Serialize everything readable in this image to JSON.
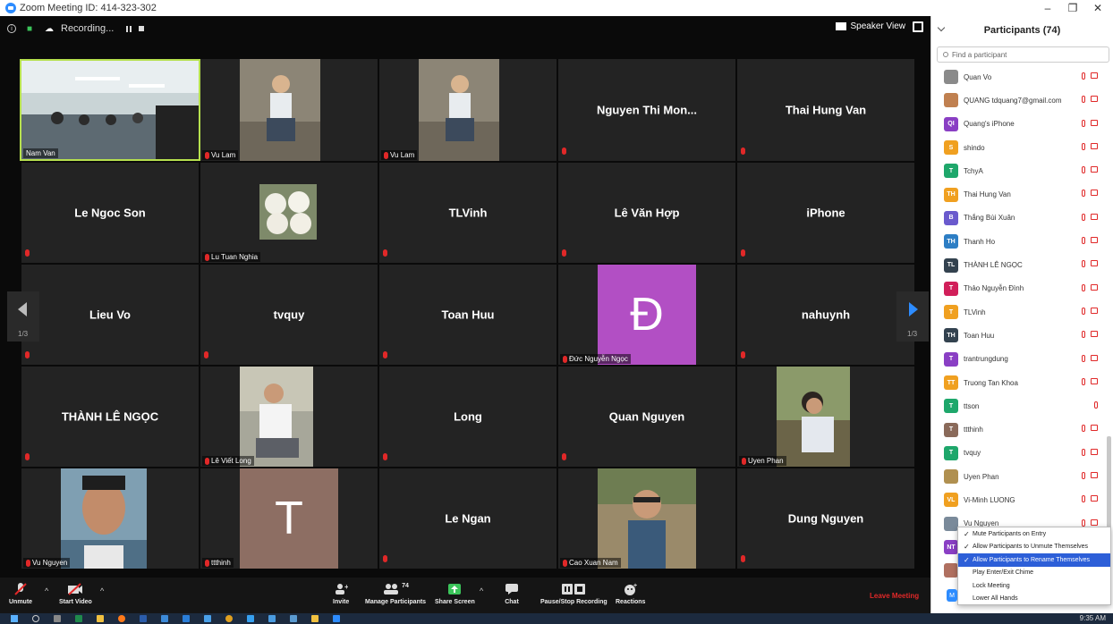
{
  "window": {
    "title": "Zoom Meeting ID: 414-323-302"
  },
  "topbar": {
    "recording_label": "Recording...",
    "speaker_view_label": "Speaker View"
  },
  "pager": {
    "left_page": "1/3",
    "right_page": "1/3"
  },
  "tiles": {
    "t1": {
      "label": "Nam Van"
    },
    "t2": {
      "label": "Vu Lam"
    },
    "t3": {
      "label": "Vu Lam"
    },
    "t4": {
      "name": "Nguyen Thi Mon..."
    },
    "t5": {
      "name": "Thai Hung Van"
    },
    "t6": {
      "name": "Le Ngoc Son"
    },
    "t7": {
      "label": "Lu Tuan Nghia"
    },
    "t8": {
      "name": "TLVinh"
    },
    "t9": {
      "name": "Lê Văn Hợp"
    },
    "t10": {
      "name": "iPhone"
    },
    "t11": {
      "name": "Lieu Vo"
    },
    "t12": {
      "name": "tvquy"
    },
    "t13": {
      "name": "Toan Huu"
    },
    "t14": {
      "label": "Đức Nguyễn Ngọc",
      "letter": "Đ"
    },
    "t15": {
      "name": "nahuynh"
    },
    "t16": {
      "name": "THÀNH LÊ NGỌC"
    },
    "t17": {
      "label": "Lê Viết Long"
    },
    "t18": {
      "name": "Long"
    },
    "t19": {
      "name": "Quan Nguyen"
    },
    "t20": {
      "label": "Uyen Phan"
    },
    "t21": {
      "label": "Vu Nguyen"
    },
    "t22": {
      "label": "ttthinh",
      "letter": "T"
    },
    "t23": {
      "name": "Le Ngan"
    },
    "t24": {
      "label": "Cao Xuan Nam"
    },
    "t25": {
      "name": "Dung Nguyen"
    }
  },
  "toolbar": {
    "unmute": "Unmute",
    "start_video": "Start Video",
    "invite": "Invite",
    "manage_participants": "Manage Participants",
    "participant_count": "74",
    "share_screen": "Share Screen",
    "chat": "Chat",
    "pause_stop_recording": "Pause/Stop Recording",
    "reactions": "Reactions",
    "leave_meeting": "Leave Meeting"
  },
  "panel": {
    "title": "Participants (74)",
    "search_placeholder": "Find a participant",
    "participants": [
      {
        "name": "Quan Vo",
        "initials": "",
        "color": "#8a8a8a"
      },
      {
        "name": "QUANG tdquang7@gmail.com",
        "initials": "",
        "color": "#c08050"
      },
      {
        "name": "Quang's iPhone",
        "initials": "QI",
        "color": "#8a3fc4"
      },
      {
        "name": "shindo",
        "initials": "S",
        "color": "#f0a020"
      },
      {
        "name": "TchyA",
        "initials": "T",
        "color": "#1ea76b"
      },
      {
        "name": "Thai Hung Van",
        "initials": "TH",
        "color": "#f0a020"
      },
      {
        "name": "Thắng Bùi Xuân",
        "initials": "B",
        "color": "#6a5acd"
      },
      {
        "name": "Thanh Ho",
        "initials": "TH",
        "color": "#2d7ec4"
      },
      {
        "name": "THÀNH LÊ NGỌC",
        "initials": "TL",
        "color": "#33424f"
      },
      {
        "name": "Thảo Nguyễn Đình",
        "initials": "T",
        "color": "#d11f5a"
      },
      {
        "name": "TLVinh",
        "initials": "T",
        "color": "#f0a020"
      },
      {
        "name": "Toan Huu",
        "initials": "TH",
        "color": "#33424f"
      },
      {
        "name": "trantrungdung",
        "initials": "T",
        "color": "#8a3fc4"
      },
      {
        "name": "Truong Tan Khoa",
        "initials": "TT",
        "color": "#f0a020"
      },
      {
        "name": "ttson",
        "initials": "T",
        "color": "#1ea76b"
      },
      {
        "name": "ttthinh",
        "initials": "T",
        "color": "#8a6a5a"
      },
      {
        "name": "tvquy",
        "initials": "T",
        "color": "#1ea76b"
      },
      {
        "name": "Uyen Phan",
        "initials": "",
        "color": "#b09050"
      },
      {
        "name": "Vi-Minh LUONG",
        "initials": "VL",
        "color": "#f0a020"
      },
      {
        "name": "Vu Nguyen",
        "initials": "",
        "color": "#7a8a9a"
      },
      {
        "name": "",
        "initials": "NT",
        "color": "#8a3fc4"
      },
      {
        "name": "",
        "initials": "",
        "color": "#b07060"
      }
    ]
  },
  "menu": {
    "items": [
      {
        "label": "Mute Participants on Entry",
        "check": "✓"
      },
      {
        "label": "Allow Participants to Unmute Themselves",
        "check": "✓"
      },
      {
        "label": "Allow Participants to Rename Themselves",
        "check": "✓"
      },
      {
        "label": "Play Enter/Exit Chime",
        "check": ""
      },
      {
        "label": "Lock Meeting",
        "check": ""
      },
      {
        "label": "Lower All Hands",
        "check": ""
      }
    ],
    "more_button": "M"
  },
  "taskbar": {
    "clock": "9:35 AM"
  },
  "colors": {
    "accent": "#2d8cff",
    "leave": "#e02828",
    "active_speaker": "#b6e04e",
    "menu_highlight": "#2d5fd8"
  }
}
